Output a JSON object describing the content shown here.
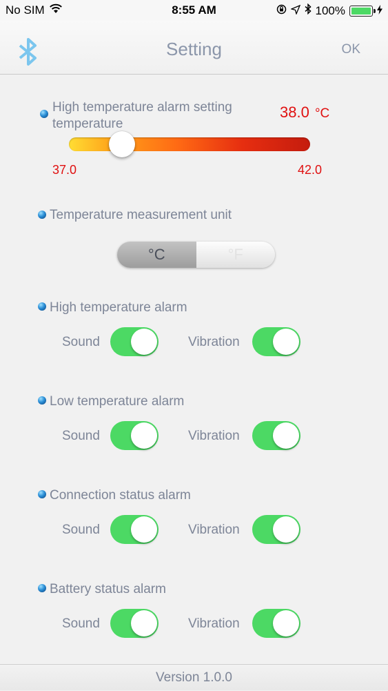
{
  "status_bar": {
    "carrier": "No SIM",
    "time": "8:55 AM",
    "battery": "100%"
  },
  "nav": {
    "title": "Setting",
    "ok_label": "OK"
  },
  "high_temp_setting": {
    "label": "High temperature alarm setting temperature",
    "value": "38.0",
    "unit": "°C",
    "min": "37.0",
    "max": "42.0",
    "level": 0.2
  },
  "unit_section": {
    "label": "Temperature measurement unit",
    "celsius": "°C",
    "fahrenheit": "°F",
    "selected": "°C"
  },
  "alarms": [
    {
      "title": "High temperature alarm",
      "sound_label": "Sound",
      "vibration_label": "Vibration",
      "sound_on": true,
      "vibration_on": true
    },
    {
      "title": "Low temperature alarm",
      "sound_label": "Sound",
      "vibration_label": "Vibration",
      "sound_on": true,
      "vibration_on": true
    },
    {
      "title": "Connection status alarm",
      "sound_label": "Sound",
      "vibration_label": "Vibration",
      "sound_on": true,
      "vibration_on": true
    },
    {
      "title": "Battery status alarm",
      "sound_label": "Sound",
      "vibration_label": "Vibration",
      "sound_on": true,
      "vibration_on": true
    }
  ],
  "footer": {
    "version": "Version 1.0.0"
  },
  "colors": {
    "accent_green": "#4cd964",
    "alert_red": "#e01010",
    "label_gray": "#7d8597"
  },
  "icons": [
    "wifi-icon",
    "location-lock-icon",
    "location-arrow-icon",
    "bluetooth-icon",
    "battery-icon",
    "charging-icon"
  ]
}
